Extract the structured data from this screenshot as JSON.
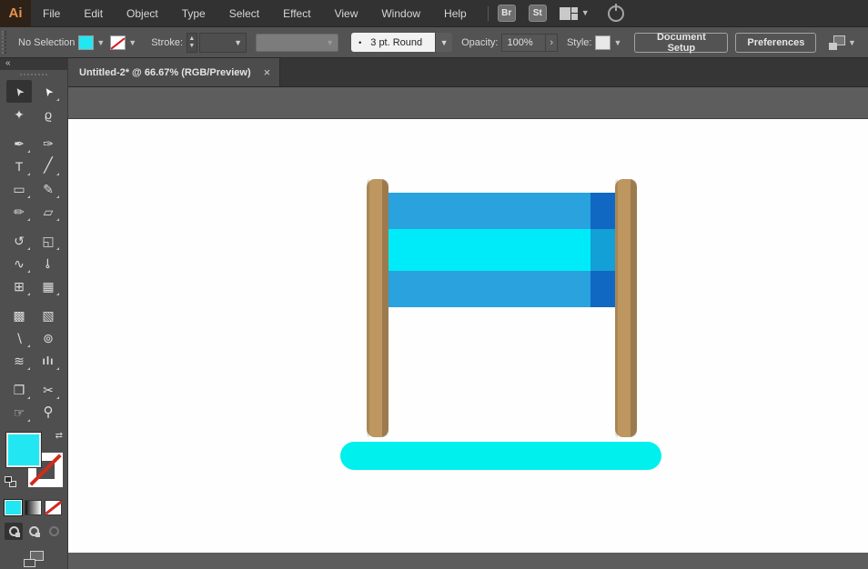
{
  "app": {
    "logo_text": "Ai"
  },
  "menu": {
    "items": [
      "File",
      "Edit",
      "Object",
      "Type",
      "Select",
      "Effect",
      "View",
      "Window",
      "Help"
    ]
  },
  "app_bar": {
    "bridge_label": "Br",
    "stock_label": "St",
    "chevron_glyph": "▼"
  },
  "control_bar": {
    "selection_status": "No Selection",
    "stroke_label": "Stroke:",
    "stepper_up": "▲",
    "stepper_down": "▼",
    "chevron_glyph": "▼",
    "brush_bullet": "•",
    "brush_value": "3 pt. Round",
    "opacity_label": "Opacity:",
    "opacity_value": "100%",
    "opacity_arrow": "›",
    "style_label": "Style:",
    "document_setup_label": "Document Setup",
    "preferences_label": "Preferences"
  },
  "document_tab": {
    "title": "Untitled-2* @ 66.67% (RGB/Preview)",
    "close_glyph": "×"
  },
  "toolbar": {
    "collapse_glyph": "«",
    "swap_glyph": "⇄",
    "fill_color": "#22E7F2",
    "tools": [
      {
        "name": "selection-tool",
        "glyph": "➤"
      },
      {
        "name": "direct-selection-tool",
        "glyph": "➤"
      },
      {
        "name": "magic-wand-tool",
        "glyph": "✦"
      },
      {
        "name": "lasso-tool",
        "glyph": "ϱ"
      },
      {
        "name": "pen-tool",
        "glyph": "✒"
      },
      {
        "name": "curvature-tool",
        "glyph": "✑"
      },
      {
        "name": "type-tool",
        "glyph": "T"
      },
      {
        "name": "line-segment-tool",
        "glyph": "╱"
      },
      {
        "name": "rectangle-tool",
        "glyph": "▭"
      },
      {
        "name": "paintbrush-tool",
        "glyph": "✎"
      },
      {
        "name": "shaper-tool",
        "glyph": "✏"
      },
      {
        "name": "eraser-tool",
        "glyph": "▱"
      },
      {
        "name": "rotate-tool",
        "glyph": "↺"
      },
      {
        "name": "scale-tool",
        "glyph": "◱"
      },
      {
        "name": "width-tool",
        "glyph": "∿"
      },
      {
        "name": "puppet-warp-tool",
        "glyph": "⊸"
      },
      {
        "name": "shape-builder-tool",
        "glyph": "⊞"
      },
      {
        "name": "perspective-grid-tool",
        "glyph": "▦"
      },
      {
        "name": "mesh-tool",
        "glyph": "▩"
      },
      {
        "name": "gradient-tool",
        "glyph": "▧"
      },
      {
        "name": "eyedropper-tool",
        "glyph": "∖"
      },
      {
        "name": "blend-tool",
        "glyph": "⊚"
      },
      {
        "name": "symbol-sprayer-tool",
        "glyph": "≋"
      },
      {
        "name": "column-graph-tool",
        "glyph": "ılı"
      },
      {
        "name": "artboard-tool",
        "glyph": "❐"
      },
      {
        "name": "slice-tool",
        "glyph": "✂"
      },
      {
        "name": "hand-tool",
        "glyph": "☞"
      },
      {
        "name": "zoom-tool",
        "glyph": "⚲"
      }
    ]
  },
  "colors": {
    "menu_bar_bg": "#323232",
    "control_bar_bg": "#535353",
    "panel_bg": "#4F4F4F",
    "tab_active_bg": "#4C4C4C",
    "pasteboard": "#5D5D5D",
    "artboard": "#FEFEFE",
    "accent_cyan": "#22E7F2"
  },
  "artwork": {
    "posts": {
      "fill": "#BD9660"
    },
    "banner": {
      "stripes": [
        {
          "color": "#2AA2DE",
          "shadow": "#1068C2"
        },
        {
          "color": "#00EBFA",
          "shadow": "#13A0D6"
        },
        {
          "color": "#2AA2DE",
          "shadow": "#1068C2"
        }
      ]
    },
    "base": {
      "fill": "#00F0EE"
    }
  }
}
